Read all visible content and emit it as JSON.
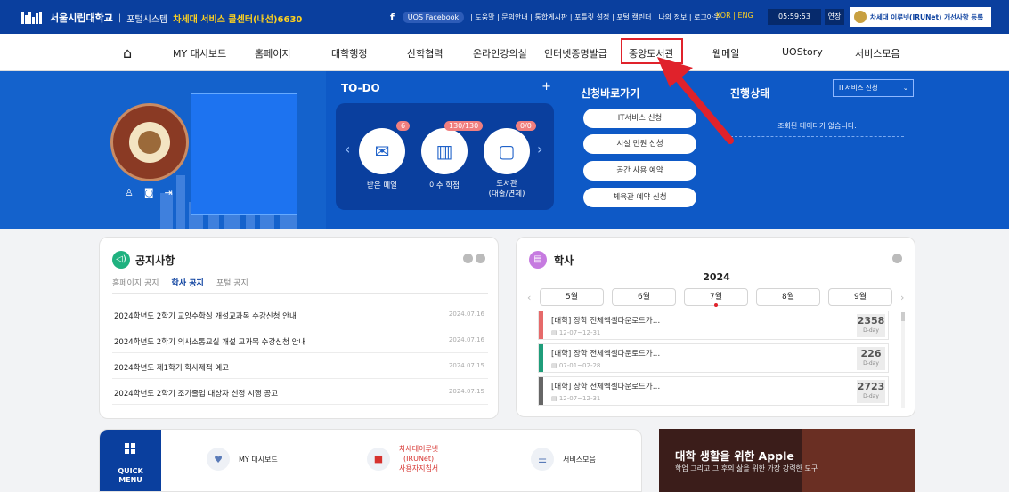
{
  "topbar": {
    "brand": "서울시립대학교",
    "system": "포털시스템",
    "callcenter": "차세대 서비스 콜센터(내선)6630",
    "fb_icon": "f",
    "fb_label": "UOS Facebook",
    "links": "| 도움말 | 문의안내 | 통합게시판 | 포틀릿 설정 | 포털 캘린더 | 나의 정보 | 로그아웃",
    "lang": "KOR | ENG",
    "timer": "05:59:53",
    "extend": "연장",
    "register": "차세대 이루넷(IRUNet) 개선사항 등록"
  },
  "gnb": {
    "home_icon": "⌂",
    "items": [
      "MY 대시보드",
      "홈페이지",
      "대학행정",
      "산학협력",
      "온라인강의실",
      "인터넷증명발급",
      "중앙도서관",
      "웹메일",
      "UOStory",
      "서비스모음"
    ]
  },
  "hero": {
    "profile_icons": [
      "user-icon",
      "camera-icon",
      "logout-icon"
    ],
    "todo": {
      "title": "TO-DO",
      "plus": "+",
      "cards": [
        {
          "label": "받은 메일",
          "badge": "6",
          "icon": "✉"
        },
        {
          "label": "이수 학점",
          "badge": "130/130",
          "icon": "▥"
        },
        {
          "label": "도서관\n(대출/연체)",
          "badge": "0/0",
          "icon": "▢"
        }
      ]
    },
    "quick": {
      "title": "신청바로가기",
      "buttons": [
        "IT서비스 신청",
        "시설 민원 신청",
        "공간 사용 예약",
        "체육관 예약 신청"
      ]
    },
    "status": {
      "title": "진행상태",
      "select": "IT서비스 신청",
      "empty": "조회된 데이터가 없습니다."
    }
  },
  "notice": {
    "title": "공지사항",
    "tabs": [
      "홈페이지 공지",
      "학사 공지",
      "포털 공지"
    ],
    "active_tab": "학사 공지",
    "rows": [
      {
        "title": "2024학년도 2학기 교양수학실 개설교과목 수강신청 안내",
        "date": "2024.07.16"
      },
      {
        "title": "2024학년도 2학기 의사소통교실 개설 교과목 수강신청 안내",
        "date": "2024.07.16"
      },
      {
        "title": "2024학년도 제1학기 학사제적 예고",
        "date": "2024.07.15"
      },
      {
        "title": "2024학년도 2학기 조기졸업 대상자 선정 시행 공고",
        "date": "2024.07.15"
      }
    ]
  },
  "calendar": {
    "title": "학사",
    "year": "2024",
    "months": [
      "5월",
      "6월",
      "7월",
      "8월",
      "9월"
    ],
    "events": [
      {
        "title": "[대학] 장학 전체엑셀다운로드가…",
        "date": "12-07~12-31",
        "dday": "2358",
        "color": "#e66a6a"
      },
      {
        "title": "[대학] 장학 전체엑셀다운로드가…",
        "date": "07-01~02-28",
        "dday": "226",
        "color": "#1f9d7a"
      },
      {
        "title": "[대학] 장학 전체엑셀다운로드가…",
        "date": "12-07~12-31",
        "dday": "2723",
        "color": "#666666"
      }
    ],
    "dday_label": "D-day"
  },
  "quickmenu": {
    "title": "QUICK\nMENU",
    "items": [
      "MY 대시보드",
      "차세대이루넷\n(IRUNet)\n사용자지침서",
      "서비스모음"
    ]
  },
  "banner": {
    "title": "대학 생활을 위한 Apple",
    "subtitle": "학업 그리고 그 후의 삶을 위한 가장 강력한 도구"
  }
}
